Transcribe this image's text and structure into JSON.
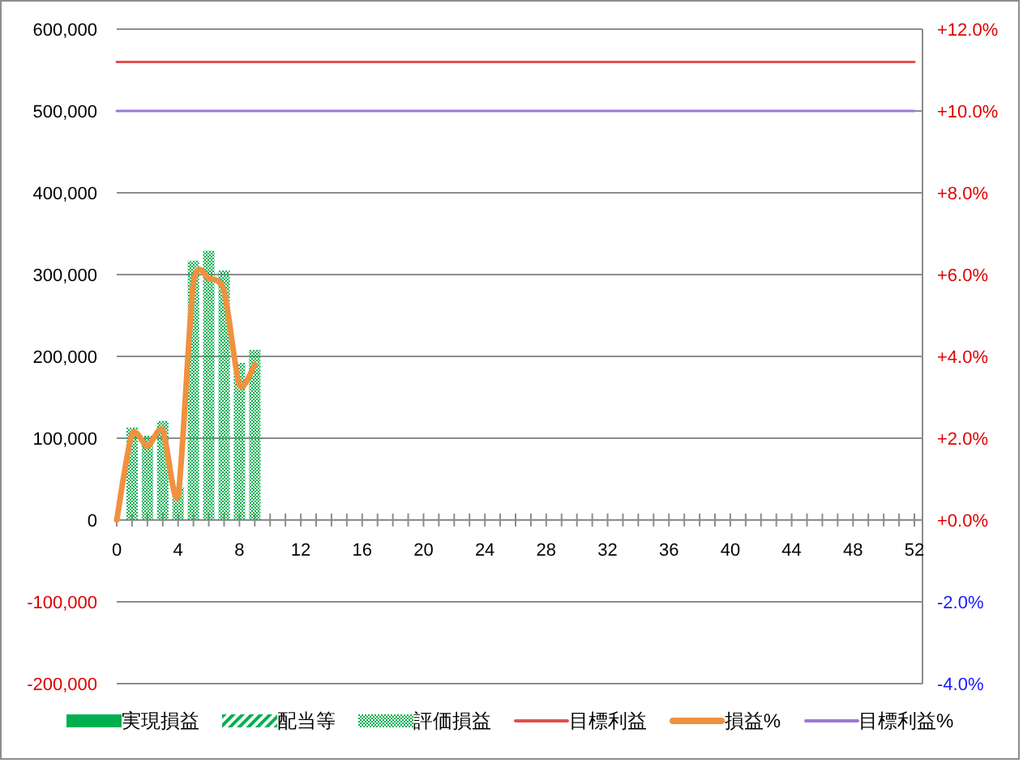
{
  "chart": {
    "chart_data": {
      "type": "bar",
      "stacked": true,
      "grid": true,
      "x": [
        0,
        1,
        2,
        3,
        4,
        5,
        6,
        7,
        8,
        9,
        10,
        11,
        12,
        13,
        14,
        15,
        16,
        17,
        18,
        19,
        20,
        21,
        22,
        23,
        24,
        25,
        26,
        27,
        28,
        29,
        30,
        31,
        32,
        33,
        34,
        35,
        36,
        37,
        38,
        39,
        40,
        41,
        42,
        43,
        44,
        45,
        46,
        47,
        48,
        49,
        50,
        51,
        52
      ],
      "xticks": [
        0,
        4,
        8,
        12,
        16,
        20,
        24,
        28,
        32,
        36,
        40,
        44,
        48,
        52
      ],
      "xlim": [
        0,
        52
      ],
      "ylim": [
        -200000,
        600000
      ],
      "yticks": [
        {
          "value": 600000,
          "label": "600,000"
        },
        {
          "value": 500000,
          "label": "500,000"
        },
        {
          "value": 400000,
          "label": "400,000"
        },
        {
          "value": 300000,
          "label": "300,000"
        },
        {
          "value": 200000,
          "label": "200,000"
        },
        {
          "value": 100000,
          "label": "100,000"
        },
        {
          "value": 0,
          "label": "0"
        },
        {
          "value": -100000,
          "label": "-100,000"
        },
        {
          "value": -200000,
          "label": "-200,000"
        }
      ],
      "y2lim": [
        -4,
        12
      ],
      "y2ticks": [
        {
          "value": 12,
          "label": "+12.0%"
        },
        {
          "value": 10,
          "label": "+10.0%"
        },
        {
          "value": 8,
          "label": "+8.0%"
        },
        {
          "value": 6,
          "label": "+6.0%"
        },
        {
          "value": 4,
          "label": "+4.0%"
        },
        {
          "value": 2,
          "label": "+2.0%"
        },
        {
          "value": 0,
          "label": "+0.0%"
        },
        {
          "value": -2,
          "label": "-2.0%"
        },
        {
          "value": -4,
          "label": "-4.0%"
        }
      ],
      "series": [
        {
          "name": "実現損益",
          "color": "#00b050",
          "values": [
            null,
            null,
            null,
            null,
            null,
            null,
            null,
            null,
            null,
            null,
            null,
            null,
            null,
            null,
            null,
            null,
            null,
            null,
            null,
            null,
            null,
            null,
            null,
            null,
            null,
            null,
            null,
            null,
            null,
            null,
            null,
            null,
            null,
            null,
            null,
            null,
            null,
            null,
            null,
            null,
            null,
            null,
            null,
            null,
            null,
            null,
            null,
            null,
            null,
            null,
            null,
            null,
            null
          ]
        },
        {
          "name": "配当等",
          "color": "#00b050",
          "values": [
            null,
            null,
            null,
            null,
            null,
            null,
            null,
            null,
            null,
            null,
            null,
            null,
            null,
            null,
            null,
            null,
            null,
            null,
            null,
            null,
            null,
            null,
            null,
            null,
            null,
            null,
            null,
            null,
            null,
            null,
            null,
            null,
            null,
            null,
            null,
            null,
            null,
            null,
            null,
            null,
            null,
            null,
            null,
            null,
            null,
            null,
            null,
            null,
            null,
            null,
            null,
            null,
            null
          ]
        },
        {
          "name": "評価損益",
          "color": "#00b050",
          "values": [
            null,
            113000,
            103000,
            121000,
            40000,
            317000,
            329000,
            305000,
            192000,
            208000,
            null,
            null,
            null,
            null,
            null,
            null,
            null,
            null,
            null,
            null,
            null,
            null,
            null,
            null,
            null,
            null,
            null,
            null,
            null,
            null,
            null,
            null,
            null,
            null,
            null,
            null,
            null,
            null,
            null,
            null,
            null,
            null,
            null,
            null,
            null,
            null,
            null,
            null,
            null,
            null,
            null,
            null,
            null
          ]
        },
        {
          "name": "目標利益",
          "type": "line",
          "color": "#e05050",
          "values": [
            560000,
            560000,
            560000,
            560000,
            560000,
            560000,
            560000,
            560000,
            560000,
            560000,
            560000,
            560000,
            560000,
            560000,
            560000,
            560000,
            560000,
            560000,
            560000,
            560000,
            560000,
            560000,
            560000,
            560000,
            560000,
            560000,
            560000,
            560000,
            560000,
            560000,
            560000,
            560000,
            560000,
            560000,
            560000,
            560000,
            560000,
            560000,
            560000,
            560000,
            560000,
            560000,
            560000,
            560000,
            560000,
            560000,
            560000,
            560000,
            560000,
            560000,
            560000,
            560000,
            560000
          ]
        },
        {
          "name": "損益%",
          "type": "line",
          "axis": "y2",
          "color": "#f0913f",
          "values": [
            0,
            2.1,
            1.8,
            2.2,
            0.6,
            5.8,
            5.9,
            5.6,
            3.3,
            3.8,
            null,
            null,
            null,
            null,
            null,
            null,
            null,
            null,
            null,
            null,
            null,
            null,
            null,
            null,
            null,
            null,
            null,
            null,
            null,
            null,
            null,
            null,
            null,
            null,
            null,
            null,
            null,
            null,
            null,
            null,
            null,
            null,
            null,
            null,
            null,
            null,
            null,
            null,
            null,
            null,
            null,
            null,
            null
          ]
        },
        {
          "name": "目標利益%",
          "type": "line",
          "axis": "y2",
          "color": "#9a7ad0",
          "values": [
            10,
            10,
            10,
            10,
            10,
            10,
            10,
            10,
            10,
            10,
            10,
            10,
            10,
            10,
            10,
            10,
            10,
            10,
            10,
            10,
            10,
            10,
            10,
            10,
            10,
            10,
            10,
            10,
            10,
            10,
            10,
            10,
            10,
            10,
            10,
            10,
            10,
            10,
            10,
            10,
            10,
            10,
            10,
            10,
            10,
            10,
            10,
            10,
            10,
            10,
            10,
            10,
            10
          ]
        }
      ]
    }
  }
}
